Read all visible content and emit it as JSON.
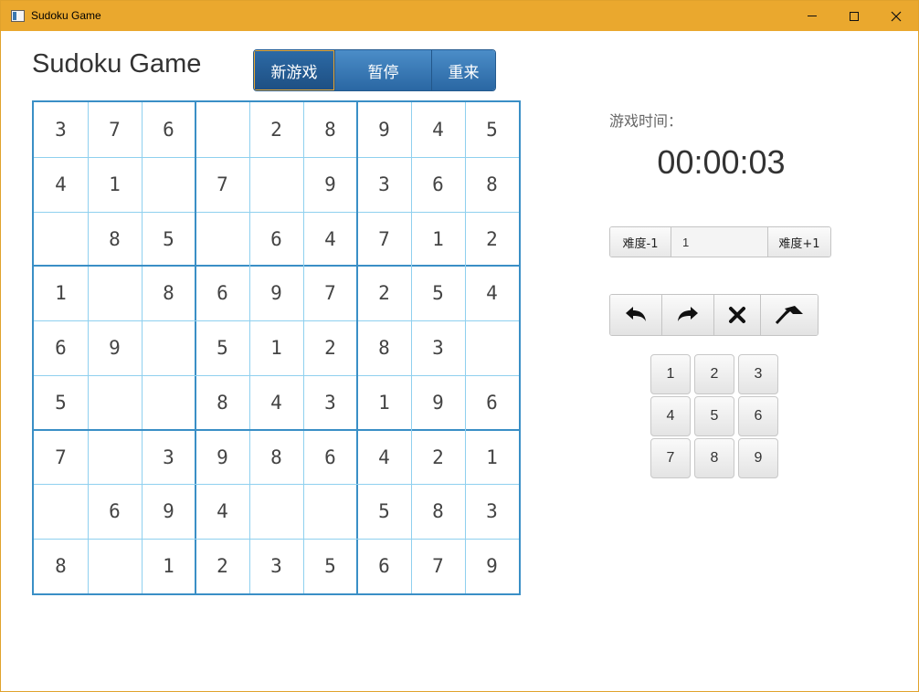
{
  "window": {
    "title": "Sudoku Game",
    "accent_color": "#eaa82e",
    "icons": {
      "minimize": "minimize-icon",
      "maximize": "maximize-icon",
      "close": "close-icon"
    }
  },
  "header": {
    "title": "Sudoku Game",
    "buttons": [
      {
        "label": "新游戏",
        "active": true
      },
      {
        "label": "暂停",
        "active": false
      },
      {
        "label": "重来",
        "active": false
      }
    ]
  },
  "board": {
    "grid_color": "#3a8fc6",
    "rows": [
      [
        "3",
        "7",
        "6",
        "",
        "2",
        "8",
        "9",
        "4",
        "5"
      ],
      [
        "4",
        "1",
        "",
        "7",
        "",
        "9",
        "3",
        "6",
        "8"
      ],
      [
        "",
        "8",
        "5",
        "",
        "6",
        "4",
        "7",
        "1",
        "2"
      ],
      [
        "1",
        "",
        "8",
        "6",
        "9",
        "7",
        "2",
        "5",
        "4"
      ],
      [
        "6",
        "9",
        "",
        "5",
        "1",
        "2",
        "8",
        "3",
        ""
      ],
      [
        "5",
        "",
        "",
        "8",
        "4",
        "3",
        "1",
        "9",
        "6"
      ],
      [
        "7",
        "",
        "3",
        "9",
        "8",
        "6",
        "4",
        "2",
        "1"
      ],
      [
        "",
        "6",
        "9",
        "4",
        "",
        "",
        "5",
        "8",
        "3"
      ],
      [
        "8",
        "",
        "1",
        "2",
        "3",
        "5",
        "6",
        "7",
        "9"
      ]
    ]
  },
  "timer": {
    "label": "游戏时间：",
    "value": "00:00:03"
  },
  "difficulty": {
    "decrease_label": "难度-1",
    "value": "1",
    "increase_label": "难度+1"
  },
  "tools": [
    {
      "icon": "undo-icon"
    },
    {
      "icon": "redo-icon"
    },
    {
      "icon": "clear-icon"
    },
    {
      "icon": "hint-icon"
    }
  ],
  "numpad": [
    "1",
    "2",
    "3",
    "4",
    "5",
    "6",
    "7",
    "8",
    "9"
  ]
}
